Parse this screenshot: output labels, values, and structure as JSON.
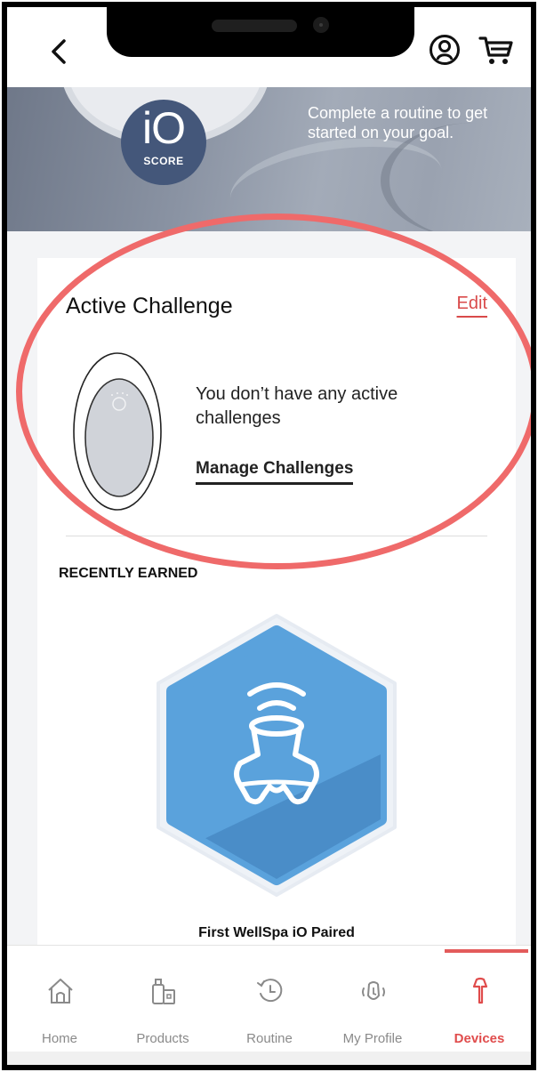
{
  "hero": {
    "badge_main": "iO",
    "badge_sub": "SCORE",
    "message": "Complete a routine to get started on your goal."
  },
  "active_challenge": {
    "title": "Active Challenge",
    "edit_label": "Edit",
    "empty_message": "You don’t have any active challenges",
    "manage_label": "Manage Challenges"
  },
  "recently_earned": {
    "heading": "RECENTLY EARNED",
    "badge_name": "First WellSpa iO Paired"
  },
  "nav": {
    "items": [
      {
        "label": "Home",
        "icon": "home-icon"
      },
      {
        "label": "Products",
        "icon": "products-icon"
      },
      {
        "label": "Routine",
        "icon": "routine-icon"
      },
      {
        "label": "My Profile",
        "icon": "profile-icon"
      },
      {
        "label": "Devices",
        "icon": "device-icon",
        "active": true
      }
    ]
  },
  "colors": {
    "accent": "#e04c4c",
    "highlight": "#ef6a6a",
    "badge_blue": "#5aa2dc",
    "badge_dark_blue": "#4a8dc8",
    "io_badge": "#44577a"
  }
}
